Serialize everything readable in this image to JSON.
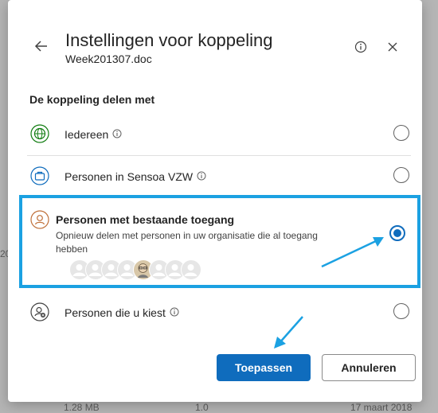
{
  "dialog": {
    "title": "Instellingen voor koppeling",
    "subtitle": "Week201307.doc",
    "section_label": "De koppeling delen met"
  },
  "options": [
    {
      "label": "Iedereen",
      "icon": "globe-icon",
      "checked": false
    },
    {
      "label": "Personen in Sensoa VZW",
      "icon": "briefcase-icon",
      "checked": false
    },
    {
      "label": "Personen met bestaande toegang",
      "description": "Opnieuw delen met personen in uw organisatie die al toegang hebben",
      "icon": "person-icon",
      "checked": true
    },
    {
      "label": "Personen die u kiest",
      "icon": "person-add-icon",
      "checked": false
    }
  ],
  "buttons": {
    "apply": "Toepassen",
    "cancel": "Annuleren"
  },
  "background": {
    "size": "1.28 MB",
    "version": "1.0",
    "date": "17 maart 2018",
    "row_fragment": "20"
  },
  "colors": {
    "accent": "#0f6cbd",
    "highlight": "#1ba1e2",
    "globe": "#107c10",
    "briefcase": "#0f6cbd",
    "person": "#c0703a"
  }
}
